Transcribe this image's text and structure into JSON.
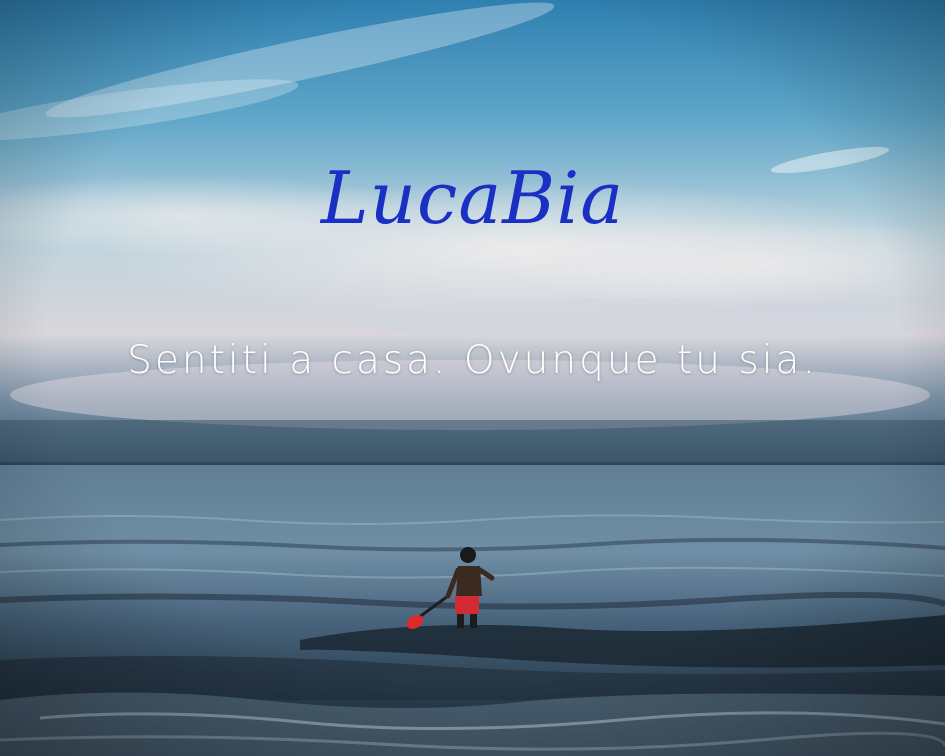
{
  "logo": {
    "text": "LucaBia",
    "color": "#1a2fc4"
  },
  "tagline": {
    "text": "Sentiti a casa. Ovunque tu sia.",
    "color": "#ffffff"
  },
  "scene": {
    "sky_colors": [
      "#2f7fb0",
      "#6fb0cf",
      "#c9dbe2",
      "#e7d9d8",
      "#39566f"
    ],
    "sea_colors": [
      "#5b7f99",
      "#3c5a72",
      "#1b2b38"
    ],
    "paddle_color": "#e02a2a",
    "shorts_color": "#d42a35"
  }
}
